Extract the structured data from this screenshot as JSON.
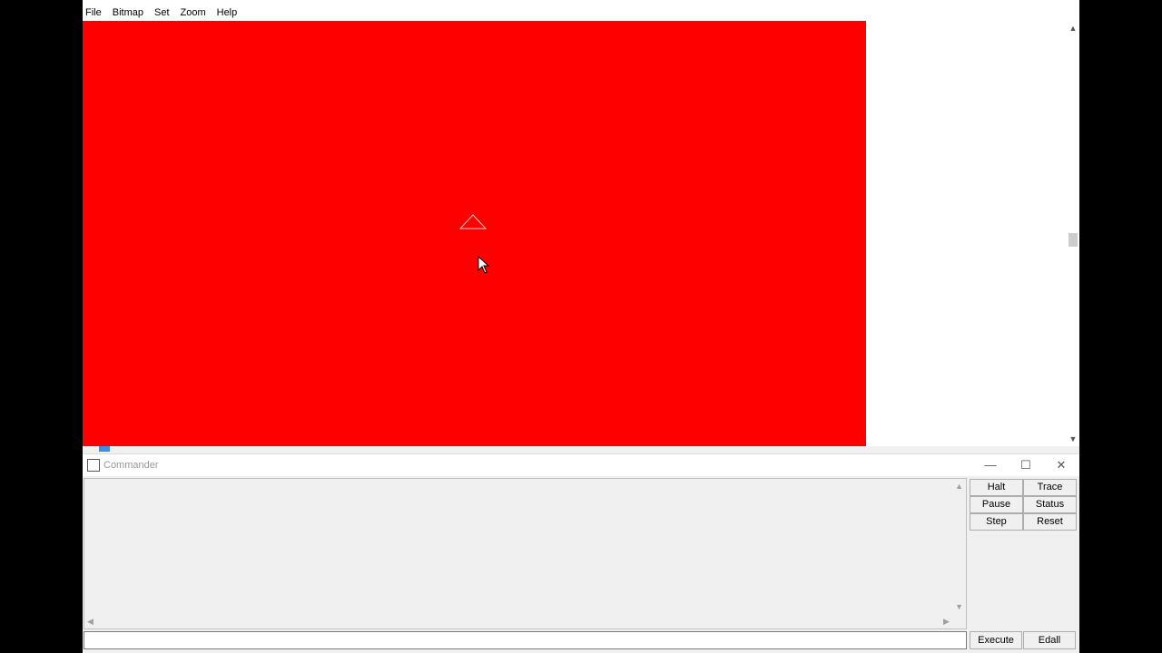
{
  "menu": [
    "File",
    "Bitmap",
    "Set",
    "Zoom",
    "Help"
  ],
  "canvas": {
    "background_color": "#ff0000"
  },
  "commander": {
    "title": "Commander",
    "window_controls": {
      "minimize": "—",
      "maximize": "☐",
      "close": "✕"
    },
    "buttons": [
      "Halt",
      "Trace",
      "Pause",
      "Status",
      "Step",
      "Reset"
    ],
    "input_value": "",
    "execute_label": "Execute",
    "edall_label": "Edall"
  }
}
